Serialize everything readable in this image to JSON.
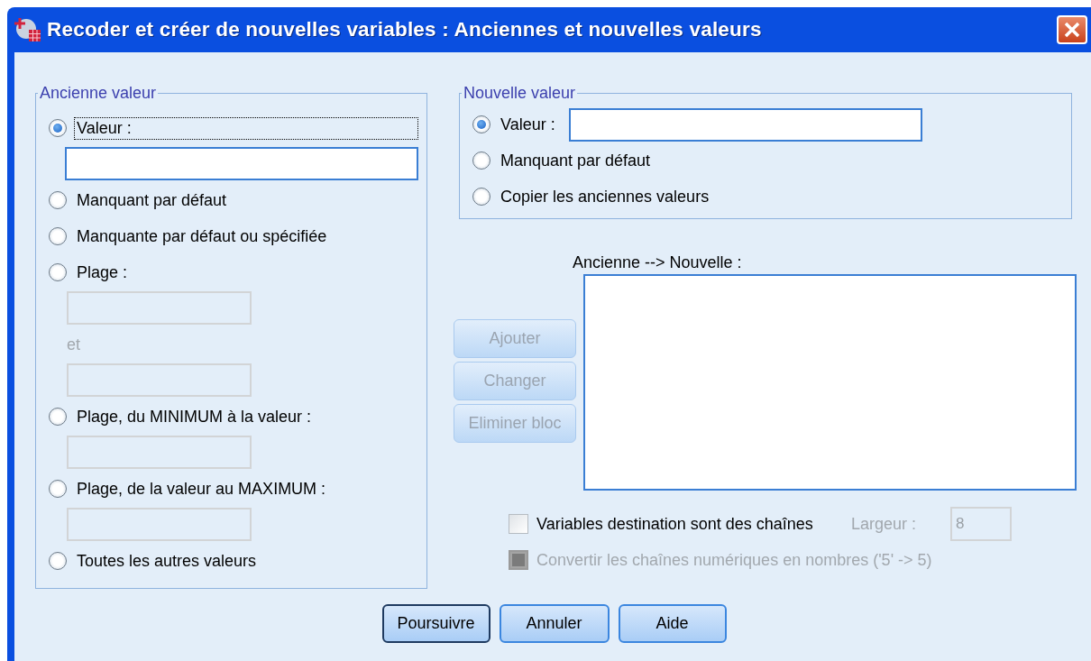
{
  "window": {
    "title": "Recoder et créer de nouvelles variables : Anciennes et nouvelles valeurs"
  },
  "old_value": {
    "legend": "Ancienne valeur",
    "items": [
      {
        "kind": "radio",
        "label": "Valeur :",
        "selected": true,
        "focused": true
      },
      {
        "kind": "field",
        "disabled": false
      },
      {
        "kind": "radio",
        "label": "Manquant par défaut",
        "selected": false,
        "focused": false
      },
      {
        "kind": "radio",
        "label": "Manquante par défaut ou spécifiée",
        "selected": false,
        "focused": false
      },
      {
        "kind": "radio",
        "label": "Plage :",
        "selected": false,
        "focused": false
      },
      {
        "kind": "field",
        "disabled": true
      },
      {
        "kind": "caption",
        "label": "et",
        "disabled": true
      },
      {
        "kind": "field",
        "disabled": true
      },
      {
        "kind": "radio",
        "label": "Plage, du MINIMUM à la valeur :",
        "selected": false,
        "focused": false
      },
      {
        "kind": "field",
        "disabled": true
      },
      {
        "kind": "radio",
        "label": "Plage, de la valeur au MAXIMUM :",
        "selected": false,
        "focused": false
      },
      {
        "kind": "field",
        "disabled": true
      },
      {
        "kind": "radio",
        "label": "Toutes les autres valeurs",
        "selected": false,
        "focused": false
      }
    ]
  },
  "new_value": {
    "legend": "Nouvelle valeur",
    "items": [
      {
        "label": "Valeur :",
        "selected": true,
        "field": {
          "disabled": false
        }
      },
      {
        "label": "Manquant par défaut",
        "selected": false
      },
      {
        "label": "Copier les anciennes valeurs",
        "selected": false
      }
    ]
  },
  "mapping": {
    "label": "Ancienne --> Nouvelle :"
  },
  "mapping_buttons": [
    {
      "label": "Ajouter",
      "disabled": true
    },
    {
      "label": "Changer",
      "disabled": true
    },
    {
      "label": "Eliminer bloc",
      "disabled": true
    }
  ],
  "options": [
    {
      "label": "Variables destination sont des chaînes",
      "checked": false,
      "disabled": false
    },
    {
      "label": "Convertir les chaînes numériques en nombres ('5' -> 5)",
      "checked": false,
      "disabled": true
    }
  ],
  "width": {
    "label": "Largeur :",
    "value": "8",
    "disabled": true
  },
  "buttons": [
    {
      "label": "Poursuivre",
      "default": true
    },
    {
      "label": "Annuler",
      "default": false
    },
    {
      "label": "Aide",
      "default": false
    }
  ]
}
